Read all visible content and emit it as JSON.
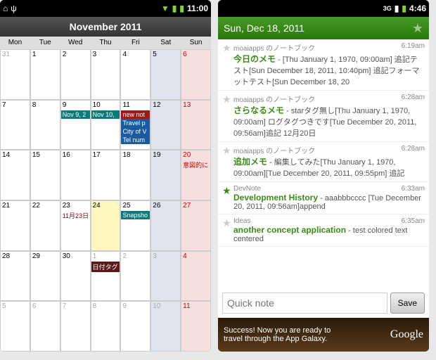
{
  "left": {
    "status": {
      "time": "11:00",
      "icons": [
        "home",
        "usb",
        "wifi",
        "signal",
        "battery"
      ]
    },
    "title": "November 2011",
    "dayHeaders": [
      "Mon",
      "Tue",
      "Wed",
      "Thu",
      "Fri",
      "Sat",
      "Sun"
    ],
    "cells": [
      {
        "n": "31",
        "cls": "gray"
      },
      {
        "n": "1"
      },
      {
        "n": "2"
      },
      {
        "n": "3"
      },
      {
        "n": "4"
      },
      {
        "n": "5",
        "cls": "sat"
      },
      {
        "n": "6",
        "cls": "sun redtext"
      },
      {
        "n": "7"
      },
      {
        "n": "8"
      },
      {
        "n": "9",
        "ev": [
          {
            "t": "Nov 9, 2",
            "c": "teal"
          }
        ]
      },
      {
        "n": "10",
        "ev": [
          {
            "t": "Nov 10,",
            "c": "teal"
          }
        ]
      },
      {
        "n": "11",
        "ev": [
          {
            "t": "new not",
            "c": "red"
          },
          {
            "t": "Travel p",
            "c": "blue"
          },
          {
            "t": "City of V",
            "c": "blue"
          },
          {
            "t": "Tel num",
            "c": "blue"
          }
        ]
      },
      {
        "n": "12",
        "cls": "sat"
      },
      {
        "n": "13",
        "cls": "sun redtext"
      },
      {
        "n": "14"
      },
      {
        "n": "15"
      },
      {
        "n": "16"
      },
      {
        "n": "17"
      },
      {
        "n": "18"
      },
      {
        "n": "19",
        "cls": "sat"
      },
      {
        "n": "20",
        "cls": "sun redtext",
        "txt": "意図的に"
      },
      {
        "n": "21"
      },
      {
        "n": "22"
      },
      {
        "n": "23",
        "txt": "11月23日",
        "txtc": "dark"
      },
      {
        "n": "24",
        "cls": "today"
      },
      {
        "n": "25",
        "ev": [
          {
            "t": "Snapsho",
            "c": "teal"
          }
        ]
      },
      {
        "n": "26",
        "cls": "sat"
      },
      {
        "n": "27",
        "cls": "sun redtext"
      },
      {
        "n": "28"
      },
      {
        "n": "29"
      },
      {
        "n": "30"
      },
      {
        "n": "1",
        "cls": "gray",
        "ev": [
          {
            "t": "日付タグ",
            "c": "dark"
          }
        ]
      },
      {
        "n": "2",
        "cls": "gray"
      },
      {
        "n": "3",
        "cls": "gray sat"
      },
      {
        "n": "4",
        "cls": "gray sun redtext"
      },
      {
        "n": "5",
        "cls": "gray"
      },
      {
        "n": "6",
        "cls": "gray"
      },
      {
        "n": "7",
        "cls": "gray"
      },
      {
        "n": "8",
        "cls": "gray"
      },
      {
        "n": "9",
        "cls": "gray"
      },
      {
        "n": "10",
        "cls": "gray sat"
      },
      {
        "n": "11",
        "cls": "gray sun redtext"
      }
    ]
  },
  "right": {
    "status": {
      "time": "4:46",
      "icons": [
        "3g",
        "signal",
        "battery"
      ]
    },
    "title": "Sun, Dec 18, 2011",
    "notes": [
      {
        "nb": "moaiapps のノートブック",
        "time": "6:19am",
        "title": "今日のメモ",
        "desc": " - [Thu January 1, 1970, 09:00am] 追記テスト[Sun December 18, 2011, 10:40pm] 追記フォーマットテスト[Sun December 18, 20",
        "fav": false
      },
      {
        "nb": "moaiapps のノートブック",
        "time": "6:28am",
        "title": "さらなるメモ",
        "desc": " - starタグ無し[Thu January 1, 1970, 09:00am] ログタグつきです[Tue December 20, 2011, 09:56am]追記 12月20日",
        "fav": false
      },
      {
        "nb": "moaiapps のノートブック",
        "time": "6:28am",
        "title": "追加メモ",
        "desc": " - 編集してみた[Thu January 1, 1970, 09:00am][Tue December 20, 2011, 09:55pm] 追記",
        "fav": false
      },
      {
        "nb": "DevNote",
        "time": "6:33am",
        "title": "Development History",
        "desc": " - aaabbbcccc   [Tue December 20, 2011, 09:56am]append",
        "fav": true
      },
      {
        "nb": "Ideas",
        "time": "6:35am",
        "title": "another concept application",
        "desc": " - test colored text centered",
        "fav": false
      }
    ],
    "quick": {
      "placeholder": "Quick note",
      "save": "Save"
    },
    "ad": {
      "text": "Success! Now you are ready to travel through the App Galaxy.",
      "brand": "Google"
    }
  }
}
